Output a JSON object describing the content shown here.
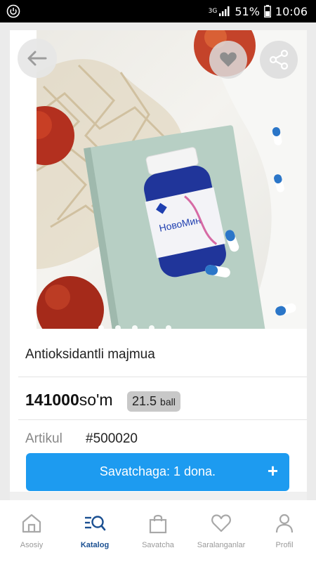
{
  "status_bar": {
    "network": "3G",
    "battery": "51%",
    "time": "10:06"
  },
  "product": {
    "title": "Antioksidantli majmua",
    "price_value": "141000",
    "price_currency": "so'm",
    "ball_value": "21.5",
    "ball_unit": "ball",
    "artikul_label": "Artikul",
    "artikul_value": "#500020",
    "image_brand_text": "НовоМин",
    "image_dots_count": 5
  },
  "cart_button": {
    "label": "Savatchaga: 1 dona.",
    "plus": "+"
  },
  "bottom_nav": [
    {
      "id": "home",
      "label": "Asosiy",
      "icon": "home-icon"
    },
    {
      "id": "catalog",
      "label": "Katalog",
      "icon": "catalog-search-icon",
      "active": true
    },
    {
      "id": "cart",
      "label": "Savatcha",
      "icon": "shopping-bag-icon"
    },
    {
      "id": "favorites",
      "label": "Saralanganlar",
      "icon": "heart-icon"
    },
    {
      "id": "profile",
      "label": "Profil",
      "icon": "user-icon"
    }
  ],
  "colors": {
    "accent": "#1d9bf0",
    "nav_active": "#1a4f91",
    "nav_inactive": "#9a9a9a"
  }
}
